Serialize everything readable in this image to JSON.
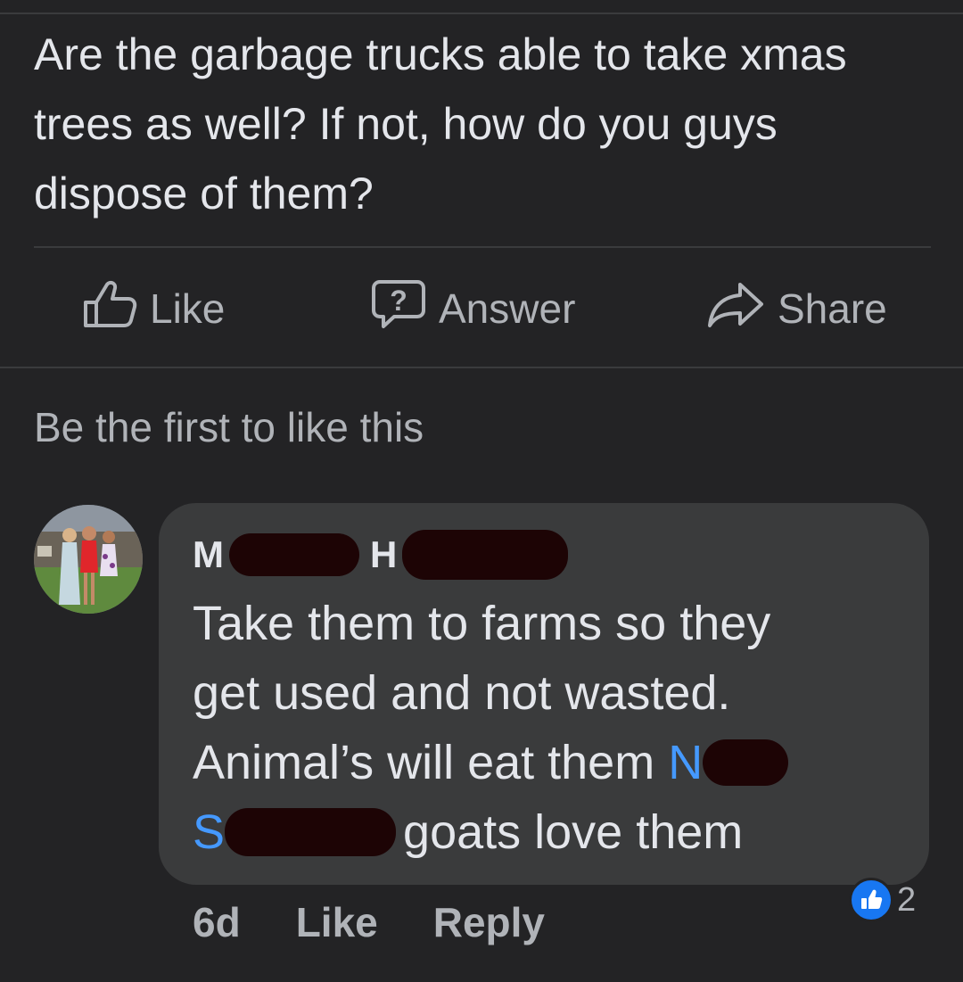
{
  "post": {
    "question": "Are the garbage trucks able to take xmas trees as well? If not, how do you guys dispose of them?",
    "actions": {
      "like_label": "Like",
      "answer_label": "Answer",
      "share_label": "Share"
    },
    "likes_summary": "Be the first to like this"
  },
  "comment": {
    "author_first_initial": "M",
    "author_last_initial": "H",
    "text_line1": "Take them to farms so they",
    "text_line2": "get used and not wasted.",
    "text_line3_start": "Animal’s will eat them ",
    "mention1_initial": "N",
    "mention2_initial": "S",
    "text_end": "goats love them",
    "time": "6d",
    "like_label": "Like",
    "reply_label": "Reply",
    "reaction_count": "2",
    "reaction_icon": "thumbs-up-icon"
  },
  "colors": {
    "background": "#232325",
    "bubble": "#3a3b3c",
    "text": "#e4e6eb",
    "muted_text": "#b0b3b8",
    "mention": "#4599ff",
    "reaction": "#1877f2",
    "redaction": "#1d0405"
  }
}
